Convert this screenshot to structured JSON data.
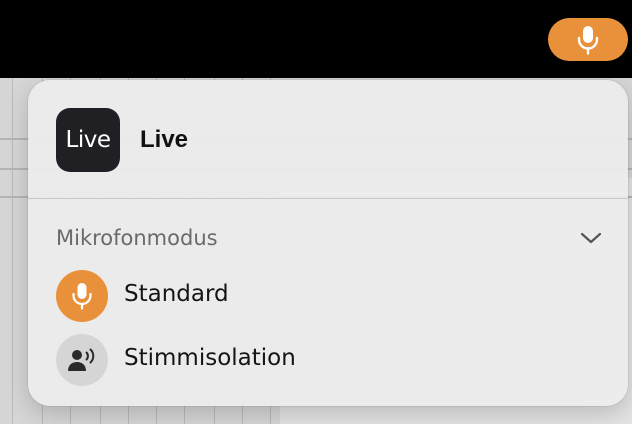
{
  "colors": {
    "accent": "#e9913a",
    "menubar": "#000000",
    "panel": "#ececec"
  },
  "menubar": {
    "mic_indicator_icon": "microphone-icon"
  },
  "popover": {
    "app": {
      "icon_text": "Live",
      "name": "Live"
    },
    "section": {
      "title": "Mikrofonmodus",
      "toggle_icon": "chevron-down-icon"
    },
    "modes": [
      {
        "label": "Standard",
        "icon": "microphone-icon",
        "selected": true
      },
      {
        "label": "Stimmisolation",
        "icon": "voice-isolation-icon",
        "selected": false
      }
    ]
  }
}
